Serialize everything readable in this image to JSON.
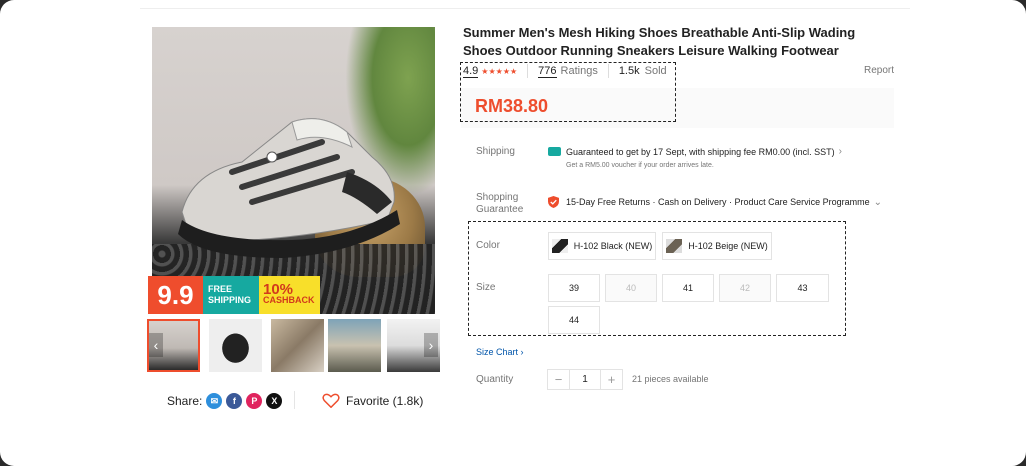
{
  "product": {
    "title": "Summer Men's Mesh Hiking Shoes Breathable Anti-Slip Wading Shoes Outdoor Running Sneakers Leisure Walking Footwear",
    "rating": "4.9",
    "stars": "★★★★★",
    "ratings_count": "776",
    "ratings_label": "Ratings",
    "sold_count": "1.5k",
    "sold_label": "Sold",
    "report_label": "Report",
    "price": "RM38.80"
  },
  "promo_banner": {
    "sale": "9.9",
    "free_line1": "FREE",
    "free_line2": "SHIPPING",
    "cash_pct": "10%",
    "cash_label": "CASHBACK"
  },
  "shipping": {
    "label": "Shipping",
    "text": "Guaranteed to get by 17 Sept, with shipping fee RM0.00 (incl. SST)",
    "sub": "Get a RM5.00 voucher if your order arrives late."
  },
  "guarantee": {
    "label_line1": "Shopping",
    "label_line2": "Guarantee",
    "text": "15-Day Free Returns · Cash on Delivery · Product Care Service Programme"
  },
  "color": {
    "label": "Color",
    "options": [
      "H-102 Black (NEW)",
      "H-102 Beige (NEW)"
    ]
  },
  "size": {
    "label": "Size",
    "options": [
      "39",
      "40",
      "41",
      "42",
      "43",
      "44"
    ]
  },
  "size_chart_label": "Size Chart",
  "quantity": {
    "label": "Quantity",
    "value": "1",
    "minus": "−",
    "plus": "+",
    "available": "21 pieces available"
  },
  "share_label": "Share:",
  "favorite_label": "Favorite (1.8k)",
  "colors": {
    "accent": "#ee4d2d",
    "link": "#0055aa"
  }
}
